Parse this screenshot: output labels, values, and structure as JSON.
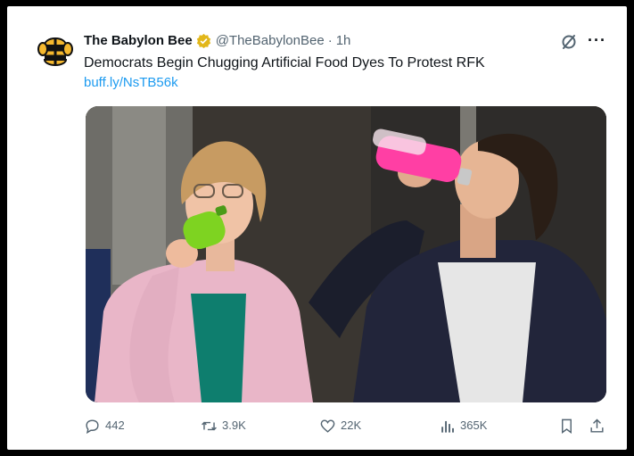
{
  "tweet": {
    "author_name": "The Babylon Bee",
    "handle": "@TheBabylonBee",
    "separator": "·",
    "time": "1h",
    "text": "Democrats Begin Chugging Artificial Food Dyes To Protest RFK",
    "link": "buff.ly/NsTB56k",
    "verified": true
  },
  "icons": {
    "avatar": "babylon-bee-logo",
    "badge": "gold-verified-badge",
    "header_action": "grok-icon",
    "menu": "more-icon"
  },
  "header": {
    "more_label": "···"
  },
  "media": {
    "description_hidden": true,
    "left_bottle_color": "#7ed321",
    "right_bottle_color": "#ff3fa4"
  },
  "actions": {
    "replies": "442",
    "reposts": "3.9K",
    "likes": "22K",
    "views": "365K"
  },
  "colors": {
    "text_primary": "#0f1419",
    "text_secondary": "#536471",
    "link": "#1d9bf0",
    "verified_gold": "#e2b719"
  }
}
